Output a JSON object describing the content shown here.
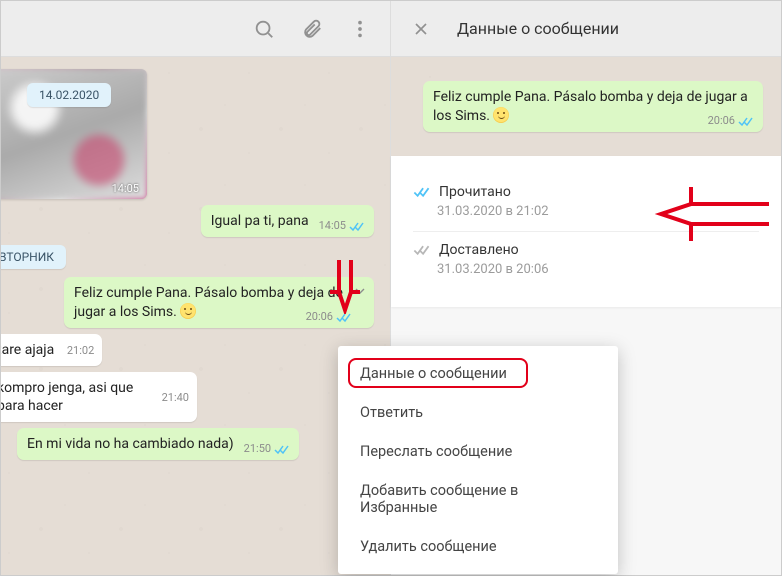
{
  "chat": {
    "date_badge": "14.02.2020",
    "media_time": "14:05",
    "msg1": {
      "text": "Igual pa ti, pana",
      "time": "14:05"
    },
    "day_badge": "ВТОРНИК",
    "msg2": {
      "text": "Feliz cumple Pana. Pásalo bomba y deja de jugar a los Sims.",
      "time": "20:06"
    },
    "msg3": {
      "text": "tare ajaja",
      "time": "21:02"
    },
    "msg4": {
      "text": "kompro jenga, asi que para hacer",
      "time": "21:40"
    },
    "msg5": {
      "text": "En  mi vida no ha cambiado nada)",
      "time": "21:50"
    }
  },
  "context_menu": {
    "items": [
      "Данные о сообщении",
      "Ответить",
      "Переслать сообщение",
      "Добавить сообщение в Избранные",
      "Удалить сообщение"
    ]
  },
  "info": {
    "title": "Данные о сообщении",
    "message": {
      "text": "Feliz cumple Pana. Pásalo bomba y deja de jugar a los Sims.",
      "time": "20:06"
    },
    "read": {
      "label": "Прочитано",
      "timestamp": "31.03.2020 в 21:02"
    },
    "delivered": {
      "label": "Доставлено",
      "timestamp": "31.03.2020 в 20:06"
    }
  }
}
